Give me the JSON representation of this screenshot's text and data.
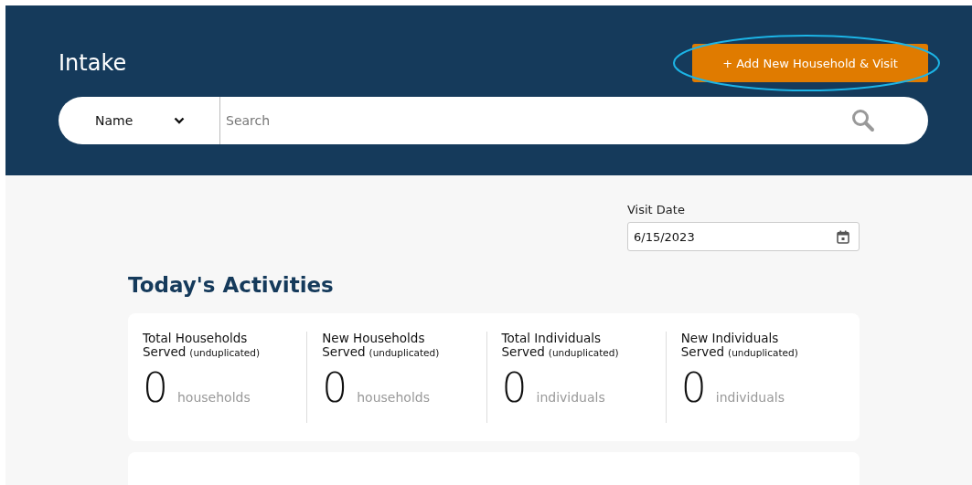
{
  "header": {
    "title": "Intake",
    "add_button": "+ Add New Household & Visit",
    "highlighted": true
  },
  "search": {
    "filter": "Name",
    "placeholder": "Search"
  },
  "visit_date": {
    "label": "Visit Date",
    "value": "6/15/2023"
  },
  "section_title": "Today's Activities",
  "stats": [
    {
      "title": "Total Households",
      "title2": "Served",
      "qualifier": "(unduplicated)",
      "value": "0",
      "unit": "households"
    },
    {
      "title": "New Households",
      "title2": "Served",
      "qualifier": "(unduplicated)",
      "value": "0",
      "unit": "households"
    },
    {
      "title": "Total Individuals",
      "title2": "Served",
      "qualifier": "(unduplicated)",
      "value": "0",
      "unit": "individuals"
    },
    {
      "title": "New Individuals",
      "title2": "Served",
      "qualifier": "(unduplicated)",
      "value": "0",
      "unit": "individuals"
    }
  ]
}
